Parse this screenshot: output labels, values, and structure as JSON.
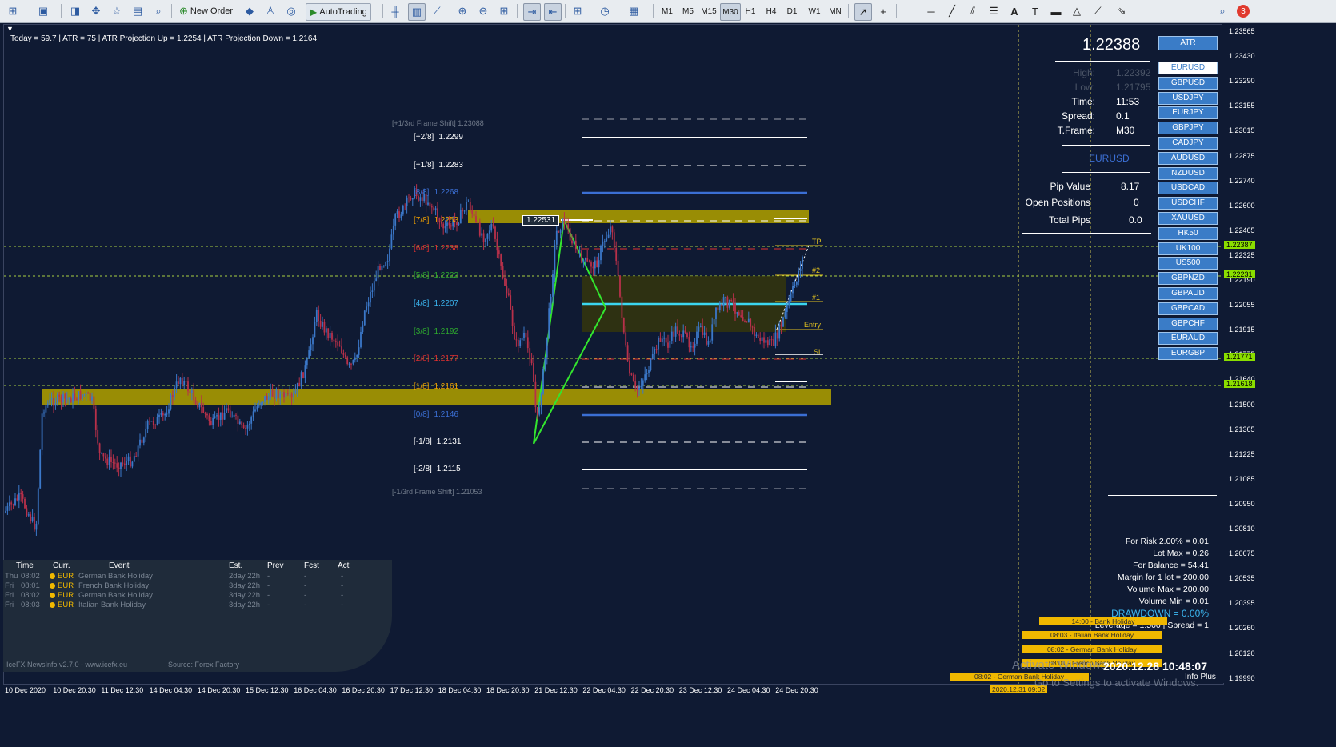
{
  "toolbar": {
    "new_order_label": "New Order",
    "autotrading_label": "AutoTrading",
    "periods": [
      "M1",
      "M5",
      "M15",
      "M30",
      "H1",
      "H4",
      "D1",
      "W1",
      "MN"
    ],
    "active_period": "M30",
    "alert_badge": "3"
  },
  "info_bar": {
    "text": "Today = 59.7   |   ATR = 75   |   ATR Projection Up = 1.2254   |   ATR Projection Down = 1.2164"
  },
  "murrey": {
    "frame_shift_up": "[+1/3rd Frame Shift]  1.23088",
    "frame_shift_down": "[-1/3rd Frame Shift]  1.21053",
    "levels": [
      {
        "label": "[+2/8]",
        "value": "1.2299",
        "color": "#ffffff"
      },
      {
        "label": "[+1/8]",
        "value": "1.2283",
        "color": "#ffffff"
      },
      {
        "label": "[8/8]",
        "value": "1.2268",
        "color": "#3b6fd4"
      },
      {
        "label": "[7/8]",
        "value": "1.2253",
        "color": "#f0a000"
      },
      {
        "label": "[6/8]",
        "value": "1.2238",
        "color": "#e03030"
      },
      {
        "label": "[5/8]",
        "value": "1.2222",
        "color": "#2ea82e"
      },
      {
        "label": "[4/8]",
        "value": "1.2207",
        "color": "#3bb6f0"
      },
      {
        "label": "[3/8]",
        "value": "1.2192",
        "color": "#2ea82e"
      },
      {
        "label": "[2/8]",
        "value": "1.2177",
        "color": "#e03030"
      },
      {
        "label": "[1/8]",
        "value": "1.2161",
        "color": "#f0a000"
      },
      {
        "label": "[0/8]",
        "value": "1.2146",
        "color": "#3b6fd4"
      },
      {
        "label": "[-1/8]",
        "value": "1.2131",
        "color": "#ffffff"
      },
      {
        "label": "[-2/8]",
        "value": "1.2115",
        "color": "#ffffff"
      }
    ]
  },
  "chart_labels": {
    "pattern_price": "1.22531",
    "tp": "TP",
    "t2": "#2",
    "t1": "#1",
    "entry": "Entry",
    "sl": "SL"
  },
  "info_panel": {
    "price": "1.22388",
    "atr_button": "ATR",
    "high_label": "High:",
    "high_value": "1.22392",
    "low_label": "Low:",
    "low_value": "1.21795",
    "time_label": "Time:",
    "time_value": "11:53",
    "spread_label": "Spread:",
    "spread_value": "0.1",
    "tframe_label": "T.Frame:",
    "tframe_value": "M30",
    "symbol": "EURUSD",
    "pip_value_label": "Pip Value",
    "pip_value": "8.17",
    "open_positions_label": "Open Positions",
    "open_positions": "0",
    "total_pips_label": "Total Pips",
    "total_pips": "0.0"
  },
  "symbols": [
    "EURUSD",
    "GBPUSD",
    "USDJPY",
    "EURJPY",
    "GBPJPY",
    "CADJPY",
    "AUDUSD",
    "NZDUSD",
    "USDCAD",
    "USDCHF",
    "XAUUSD",
    "HK50",
    "UK100",
    "US500",
    "GBPNZD",
    "GBPAUD",
    "GBPCAD",
    "GBPCHF",
    "EURAUD",
    "EURGBP"
  ],
  "active_symbol": "EURUSD",
  "risk": {
    "for_risk": "For Risk 2.00% = 0.01",
    "lot_max": "Lot Max = 0.26",
    "for_balance": "For Balance = 54.41",
    "margin": "Margin for 1 lot = 200.00",
    "volume_max": "Volume Max = 200.00",
    "volume_min": "Volume Min = 0.01",
    "drawdown": "DRAWDOWN =  0.00%",
    "leverage": "Leverage = 1:500 | Spread = 1"
  },
  "holidays": [
    "14:00 - Bank Holiday",
    "08:03 - Italian Bank Holiday",
    "08:02 - German Bank Holiday",
    "08:01 - French Bank Holiday",
    "08:02 - German Bank Holiday"
  ],
  "datetime": "2020.12.28 10:48:07",
  "datetime_box": "2020.12.31 09:02",
  "watermark_line1": "Activate Windows",
  "watermark_line2": "Go to Settings to activate Windows.",
  "info_plus": "Info Plus",
  "price_axis": [
    "1.23565",
    "1.23430",
    "1.23290",
    "1.23155",
    "1.23015",
    "1.22875",
    "1.22740",
    "1.22600",
    "1.22465",
    "1.22325",
    "1.22190",
    "1.22055",
    "1.21915",
    "1.21775",
    "1.21640",
    "1.21500",
    "1.21365",
    "1.21225",
    "1.21085",
    "1.20950",
    "1.20810",
    "1.20675",
    "1.20535",
    "1.20395",
    "1.20260",
    "1.20120",
    "1.19990"
  ],
  "price_highlights": [
    "1.22387",
    "1.22231",
    "1.21771",
    "1.21618"
  ],
  "time_axis": [
    "10 Dec 2020",
    "10 Dec 20:30",
    "11 Dec 12:30",
    "14 Dec 04:30",
    "14 Dec 20:30",
    "15 Dec 12:30",
    "16 Dec 04:30",
    "16 Dec 20:30",
    "17 Dec 12:30",
    "18 Dec 04:30",
    "18 Dec 20:30",
    "21 Dec 12:30",
    "22 Dec 04:30",
    "22 Dec 20:30",
    "23 Dec 12:30",
    "24 Dec 04:30",
    "24 Dec 20:30"
  ],
  "news": {
    "headers": [
      "Time",
      "Curr.",
      "Event",
      "Est.",
      "Prev",
      "Fcst",
      "Act"
    ],
    "rows": [
      {
        "day": "Thu",
        "time": "08:02",
        "curr": "EUR",
        "event": "German Bank Holiday",
        "est": "2day 22h",
        "prev": "-",
        "fcst": "-",
        "act": "-"
      },
      {
        "day": "Fri",
        "time": "08:01",
        "curr": "EUR",
        "event": "French Bank Holiday",
        "est": "3day 22h",
        "prev": "-",
        "fcst": "-",
        "act": "-"
      },
      {
        "day": "Fri",
        "time": "08:02",
        "curr": "EUR",
        "event": "German Bank Holiday",
        "est": "3day 22h",
        "prev": "-",
        "fcst": "-",
        "act": "-"
      },
      {
        "day": "Fri",
        "time": "08:03",
        "curr": "EUR",
        "event": "Italian Bank Holiday",
        "est": "3day 22h",
        "prev": "-",
        "fcst": "-",
        "act": "-"
      }
    ],
    "footer_left": "IceFX NewsInfo v2.7.0  -  www.icefx.eu",
    "footer_right": "Source: Forex Factory"
  },
  "colors": {
    "background": "#0f1a33",
    "bull": "#3b78c9",
    "bear": "#b8304a",
    "zone": "#a89a00",
    "pattern": "#33e62e"
  }
}
